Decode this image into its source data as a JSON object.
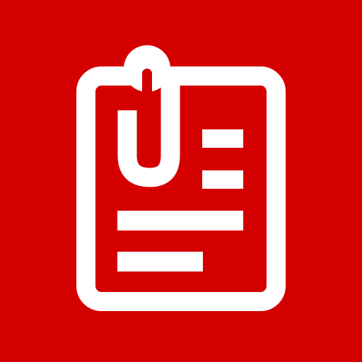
{
  "icon": {
    "name": "attached-document-icon",
    "background_color": "#d40000",
    "foreground_color": "#ffffff",
    "parts": [
      "clipboard-outline",
      "paperclip",
      "text-line-short-1",
      "text-line-short-2",
      "text-line-long",
      "text-line-medium"
    ]
  }
}
